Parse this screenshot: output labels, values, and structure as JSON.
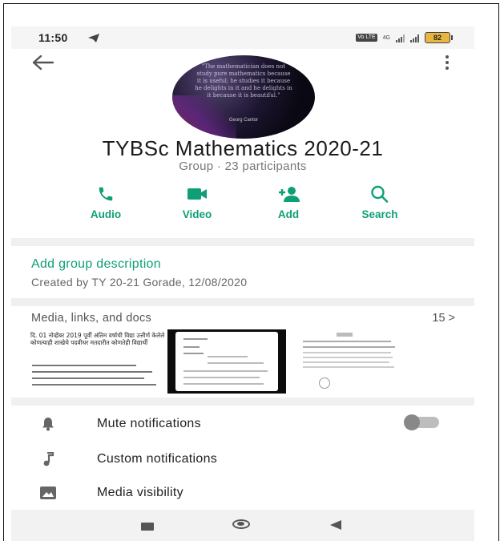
{
  "status_bar": {
    "time": "11:50",
    "volte": "Vo LTE",
    "network": "4G",
    "battery": "82"
  },
  "group": {
    "title": "TYBSc Mathematics 2020-21",
    "subtitle": "Group · 23 participants",
    "avatar_quote": "\"The mathematician does not study pure mathematics because it is useful; he studies it because he delights in it and he delights in it because it is beautiful.\"",
    "avatar_author": "Georg Cantor"
  },
  "actions": [
    {
      "label": "Audio",
      "icon": "phone-icon"
    },
    {
      "label": "Video",
      "icon": "video-camera-icon"
    },
    {
      "label": "Add",
      "icon": "add-person-icon"
    },
    {
      "label": "Search",
      "icon": "search-icon"
    }
  ],
  "description": {
    "add_label": "Add group description",
    "created": "Created by TY 20-21 Gorade, 12/08/2020"
  },
  "media": {
    "header": "Media, links, and docs",
    "count": "15 >",
    "thumb1_text": "दि. 01 नोव्हेंबर 2019 पूर्वी अंतिम वर्षाची विद्या उत्तीर्ण केलेले कोणत्याही शाखेचे पदवीधर मतदारीत कोणतेही विद्यार्थी"
  },
  "settings": [
    {
      "label": "Mute notifications",
      "icon": "bell-icon",
      "toggle": "off"
    },
    {
      "label": "Custom notifications",
      "icon": "music-note-icon"
    },
    {
      "label": "Media visibility",
      "icon": "image-icon"
    }
  ],
  "colors": {
    "accent": "#0e9f76",
    "battery": "#e8b640"
  }
}
